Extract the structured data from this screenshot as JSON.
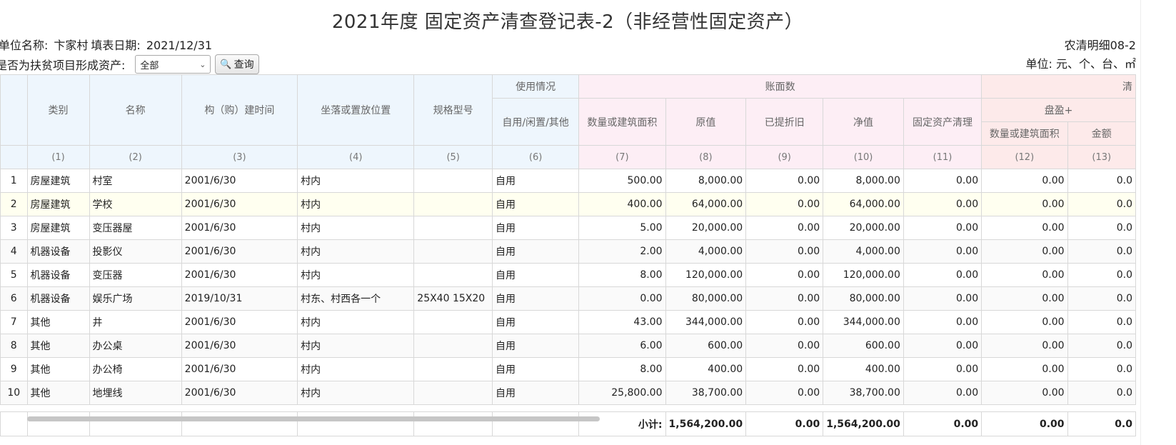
{
  "title": "2021年度 固定资产清查登记表-2（非经营性固定资产）",
  "unit_label": "单位名称:",
  "unit_name": "卞家村",
  "date_label": "填表日期:",
  "date_value": "2021/12/31",
  "poverty_label": "是否为扶贫项目形成资产:",
  "poverty_select": "全部",
  "query_button": "查询",
  "form_code": "农清明细08-2",
  "units_text": "单位: 元、个、台、㎡",
  "headers": {
    "category": "类别",
    "name": "名称",
    "build_time": "构（购）建时间",
    "location": "坐落或置放位置",
    "spec": "规格型号",
    "usage_group": "使用情况",
    "usage": "自用/闲置/其他",
    "book_group": "账面数",
    "qty": "数量或建筑面积",
    "original": "原值",
    "depreciation": "已提折旧",
    "net": "净值",
    "cleanup": "固定资产清理",
    "check_group": "清",
    "surplus_group": "盘盈+",
    "surplus_qty": "数量或建筑面积",
    "surplus_amount": "金额"
  },
  "col_numbers": [
    "(1)",
    "(2)",
    "(3)",
    "(4)",
    "(5)",
    "(6)",
    "(7)",
    "(8)",
    "(9)",
    "(10)",
    "(11)",
    "(12)",
    "(13)"
  ],
  "rows": [
    [
      "1",
      "房屋建筑",
      "村室",
      "2001/6/30",
      "村内",
      "",
      "自用",
      "500.00",
      "8,000.00",
      "0.00",
      "8,000.00",
      "0.00",
      "0.00",
      "0.0"
    ],
    [
      "2",
      "房屋建筑",
      "学校",
      "2001/6/30",
      "村内",
      "",
      "自用",
      "400.00",
      "64,000.00",
      "0.00",
      "64,000.00",
      "0.00",
      "0.00",
      "0.0"
    ],
    [
      "3",
      "房屋建筑",
      "变压器屋",
      "2001/6/30",
      "村内",
      "",
      "自用",
      "5.00",
      "20,000.00",
      "0.00",
      "20,000.00",
      "0.00",
      "0.00",
      "0.0"
    ],
    [
      "4",
      "机器设备",
      "投影仪",
      "2001/6/30",
      "村内",
      "",
      "自用",
      "2.00",
      "4,000.00",
      "0.00",
      "4,000.00",
      "0.00",
      "0.00",
      "0.0"
    ],
    [
      "5",
      "机器设备",
      "变压器",
      "2001/6/30",
      "村内",
      "",
      "自用",
      "8.00",
      "120,000.00",
      "0.00",
      "120,000.00",
      "0.00",
      "0.00",
      "0.0"
    ],
    [
      "6",
      "机器设备",
      "娱乐广场",
      "2019/10/31",
      "村东、村西各一个",
      "25X40 15X20",
      "自用",
      "0.00",
      "80,000.00",
      "0.00",
      "80,000.00",
      "0.00",
      "0.00",
      "0.0"
    ],
    [
      "7",
      "其他",
      "井",
      "2001/6/30",
      "村内",
      "",
      "自用",
      "43.00",
      "344,000.00",
      "0.00",
      "344,000.00",
      "0.00",
      "0.00",
      "0.0"
    ],
    [
      "8",
      "其他",
      "办公桌",
      "2001/6/30",
      "村内",
      "",
      "自用",
      "6.00",
      "600.00",
      "0.00",
      "600.00",
      "0.00",
      "0.00",
      "0.0"
    ],
    [
      "9",
      "其他",
      "办公椅",
      "2001/6/30",
      "村内",
      "",
      "自用",
      "8.00",
      "400.00",
      "0.00",
      "400.00",
      "0.00",
      "0.00",
      "0.0"
    ],
    [
      "10",
      "其他",
      "地埋线",
      "2001/6/30",
      "村内",
      "",
      "自用",
      "25,800.00",
      "38,700.00",
      "0.00",
      "38,700.00",
      "0.00",
      "0.00",
      "0.0"
    ]
  ],
  "subtotal": {
    "label": "小计:",
    "original": "1,564,200.00",
    "depreciation": "0.00",
    "net": "1,564,200.00",
    "cleanup": "0.00",
    "surplus_qty": "0.00",
    "surplus_amount": "0.0"
  }
}
